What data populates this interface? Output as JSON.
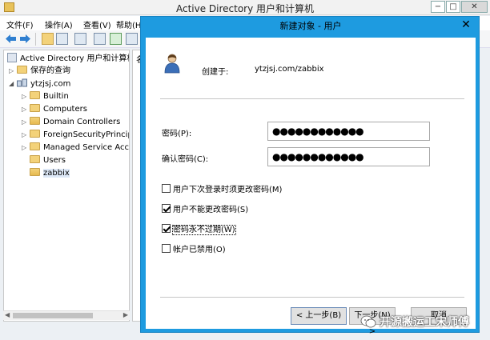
{
  "mmc": {
    "title": "Active Directory 用户和计算机",
    "menu": [
      "文件(F)",
      "操作(A)",
      "查看(V)",
      "帮助(H"
    ],
    "right_pane_fragment": "名",
    "tree": {
      "root": "Active Directory 用户和计算机",
      "items": [
        {
          "label": "保存的查询",
          "indent": 1,
          "arrow": "▷",
          "icon": "folder-icon"
        },
        {
          "label": "ytzjsj.com",
          "indent": 1,
          "arrow": "◢",
          "icon": "domain-icon"
        },
        {
          "label": "Builtin",
          "indent": 2,
          "arrow": "▷",
          "icon": "folder-icon"
        },
        {
          "label": "Computers",
          "indent": 2,
          "arrow": "▷",
          "icon": "folder-icon"
        },
        {
          "label": "Domain Controllers",
          "indent": 2,
          "arrow": "▷",
          "icon": "ou-icon"
        },
        {
          "label": "ForeignSecurityPrincipa",
          "indent": 2,
          "arrow": "▷",
          "icon": "folder-icon"
        },
        {
          "label": "Managed Service Acco",
          "indent": 2,
          "arrow": "▷",
          "icon": "folder-icon"
        },
        {
          "label": "Users",
          "indent": 2,
          "arrow": "",
          "icon": "folder-icon"
        },
        {
          "label": "zabbix",
          "indent": 2,
          "arrow": "",
          "icon": "ou-icon",
          "selected": true
        }
      ]
    }
  },
  "dialog": {
    "title": "新建对象 - 用户",
    "close_glyph": "✕",
    "create_in_label": "创建于:",
    "create_in_value": "ytzjsj.com/zabbix",
    "password_label": "密码(P):",
    "password_value": "●●●●●●●●●●●●",
    "confirm_label": "确认密码(C):",
    "confirm_value": "●●●●●●●●●●●●",
    "options": [
      {
        "label": "用户下次登录时须更改密码(M)",
        "checked": false
      },
      {
        "label": "用户不能更改密码(S)",
        "checked": true
      },
      {
        "label": "密码永不过期(W)",
        "checked": true,
        "focused": true
      },
      {
        "label": "帐户已禁用(O)",
        "checked": false
      }
    ],
    "buttons": {
      "back": "< 上一步(B)",
      "next": "下一步(N) >",
      "cancel": "取消"
    }
  },
  "watermark": {
    "text": "开源搬运工宋师傅"
  },
  "colors": {
    "dialog_title_bar": "#1e9be0",
    "tree_selected": "#dde8f7",
    "folder": "#f3d27a"
  }
}
